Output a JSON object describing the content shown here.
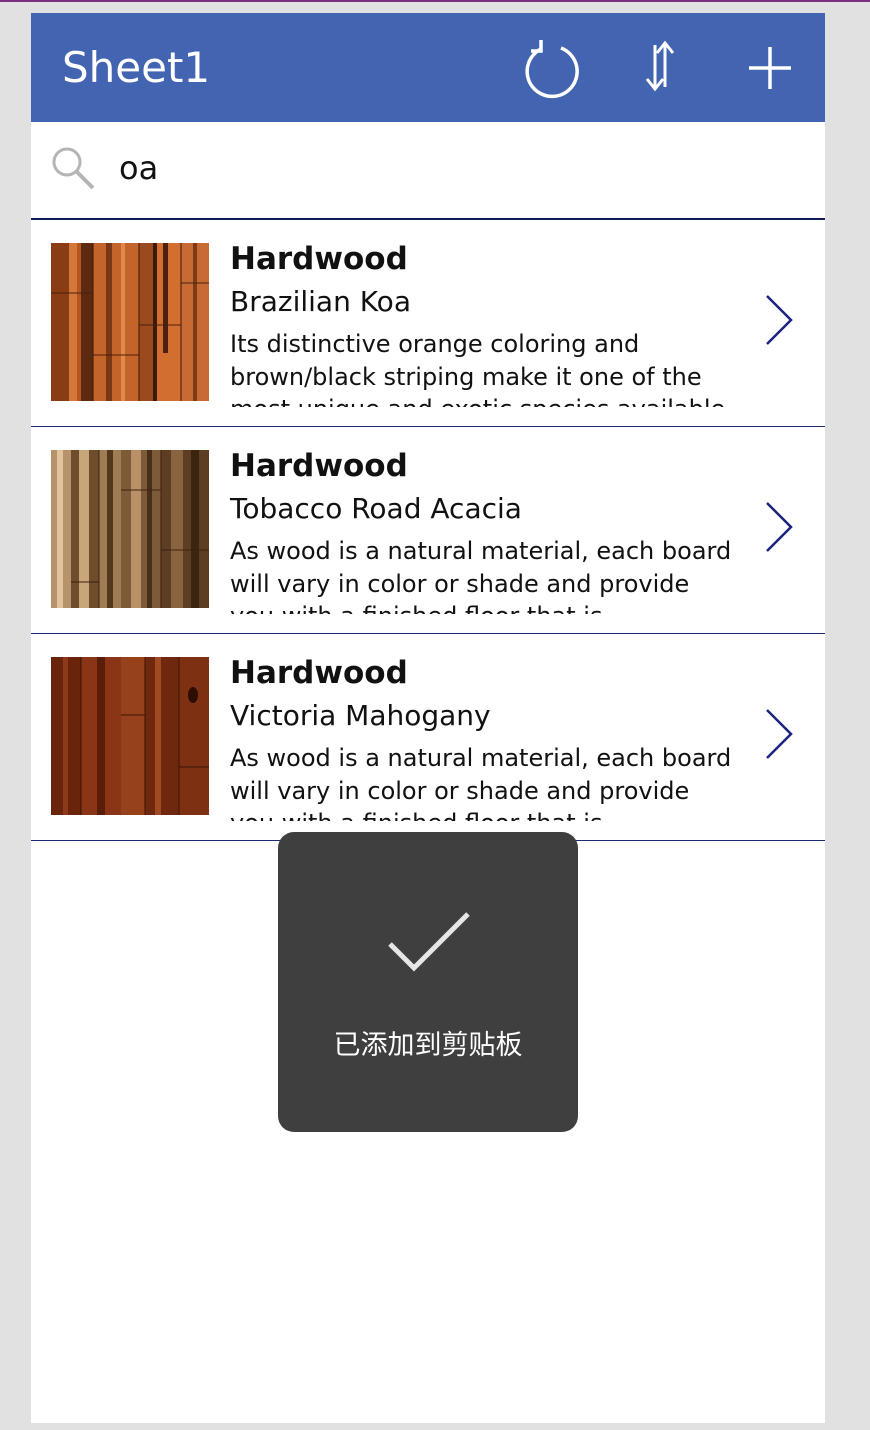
{
  "header": {
    "title": "Sheet1",
    "refresh_icon": "refresh-icon",
    "sort_icon": "sort-icon",
    "add_icon": "plus-icon",
    "bg_color": "#4364b0"
  },
  "search": {
    "value": "oa",
    "icon": "search-icon"
  },
  "items": [
    {
      "category": "Hardwood",
      "name": "Brazilian Koa",
      "description": "Its distinctive orange coloring and brown/black striping make it one of the most unique and exotic species available",
      "thumbnail": "brazilian-koa-wood-thumbnail"
    },
    {
      "category": "Hardwood",
      "name": "Tobacco Road Acacia",
      "description": "As wood is a natural material, each board will vary in color or shade and provide you with a finished floor that is",
      "thumbnail": "tobacco-road-acacia-wood-thumbnail"
    },
    {
      "category": "Hardwood",
      "name": "Victoria Mahogany",
      "description": "As wood is a natural material, each board will vary in color or shade and provide you with a finished floor that is",
      "thumbnail": "victoria-mahogany-wood-thumbnail"
    }
  ],
  "toast": {
    "icon": "checkmark-icon",
    "message": "已添加到剪贴板"
  }
}
